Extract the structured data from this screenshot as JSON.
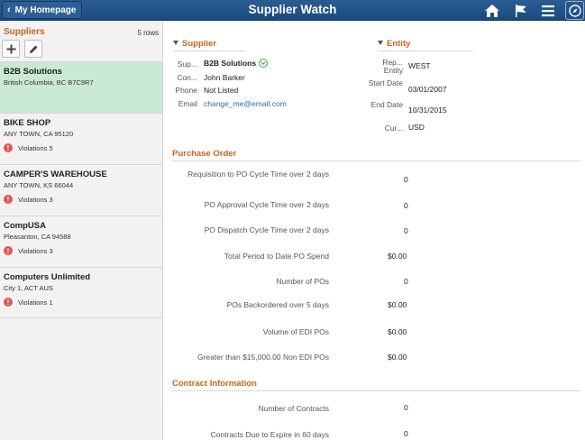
{
  "header": {
    "back_label": "My Homepage",
    "title": "Supplier Watch",
    "icons": [
      "home-icon",
      "flag-icon",
      "menu-icon",
      "nav-compass-icon"
    ]
  },
  "list": {
    "title": "Suppliers",
    "count": "5 rows",
    "add_icon": "plus-icon",
    "edit_icon": "pencil-icon",
    "items": [
      {
        "name": "B2B Solutions",
        "address": "British Columbia, BC  B7C9R7",
        "violations": ""
      },
      {
        "name": "BIKE SHOP",
        "address": "ANY TOWN, CA  95120",
        "violations": "Violations 5"
      },
      {
        "name": "CAMPER'S WAREHOUSE",
        "address": "ANY TOWN, KS  66044",
        "violations": "Violations 3"
      },
      {
        "name": "CompUSA",
        "address": "Pleasanton, CA  94588",
        "violations": "Violations 3"
      },
      {
        "name": "Computers Unlimited",
        "address": "City 1, ACT  AUS",
        "violations": "Violations 1"
      }
    ]
  },
  "supplier": {
    "heading": "Supplier",
    "supplier_label": "Sup...",
    "supplier_value": "B2B Solutions",
    "contact_label": "Con...",
    "contact_value": "John Barker",
    "phone_label": "Phone",
    "phone_value": "Not Listed",
    "email_label": "Email",
    "email_value": "change_me@email.com"
  },
  "entity": {
    "heading": "Entity",
    "rep_label": "Rep... Entity",
    "rep_value": "WEST",
    "start_label": "Start Date",
    "start_value": "03/01/2007",
    "end_label": "End Date",
    "end_value": "10/31/2015",
    "cur_label": "Cur...",
    "cur_value": "USD"
  },
  "purchase_order": {
    "heading": "Purchase Order",
    "rows": [
      {
        "label": "Requisition to PO Cycle Time over 2 days",
        "value": "0"
      },
      {
        "label": "PO Approval Cycle Time over 2 days",
        "value": "0"
      },
      {
        "label": "PO Dispatch Cycle Time over 2 days",
        "value": "0"
      },
      {
        "label": "Total Period to Date PO Spend",
        "value": "$0.00"
      },
      {
        "label": "Number of POs",
        "value": "0"
      },
      {
        "label": "POs Backordered over 5 days",
        "value": "$0.00"
      },
      {
        "label": "Volume of EDI POs",
        "value": "$0.00"
      },
      {
        "label": "Greater than $15,000.00 Non EDI POs",
        "value": "$0.00"
      }
    ]
  },
  "contract": {
    "heading": "Contract Information",
    "rows": [
      {
        "label": "Number of Contracts",
        "value": "0"
      },
      {
        "label": "Contracts Due to Expire in 60 days",
        "value": "0"
      }
    ]
  },
  "colors": {
    "header_bg": "#1f5089",
    "accent_orange": "#c8641e",
    "selected_row": "#c9e9d2",
    "alert_red": "#e05555",
    "link_blue": "#2f66b3"
  }
}
